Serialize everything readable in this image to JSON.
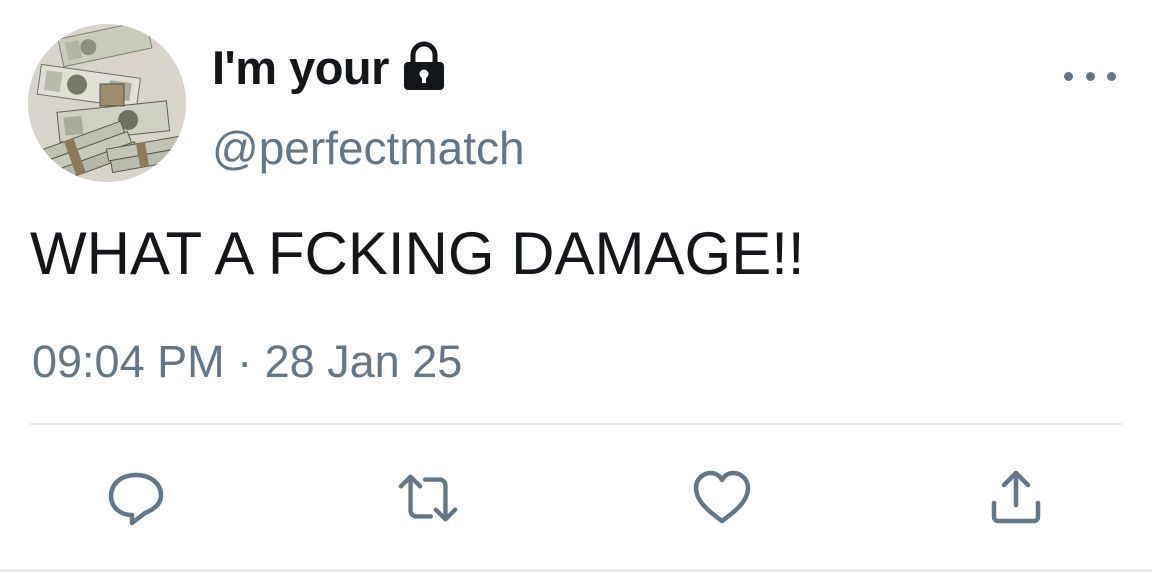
{
  "tweet": {
    "display_name": "I'm your",
    "name_icon": "lock-icon",
    "handle": "@perfectmatch",
    "text": "WHAT A FCKING DAMAGE!!",
    "timestamp": "09:04 PM · 28 Jan 25",
    "avatar": "stacks-of-dollar-bills-photo"
  },
  "actions": {
    "reply": "reply-icon",
    "retweet": "retweet-icon",
    "like": "heart-icon",
    "share": "share-icon",
    "more": "more-icon"
  },
  "colors": {
    "text": "#14171a",
    "secondary": "#657786",
    "divider": "#e6ecf0"
  }
}
